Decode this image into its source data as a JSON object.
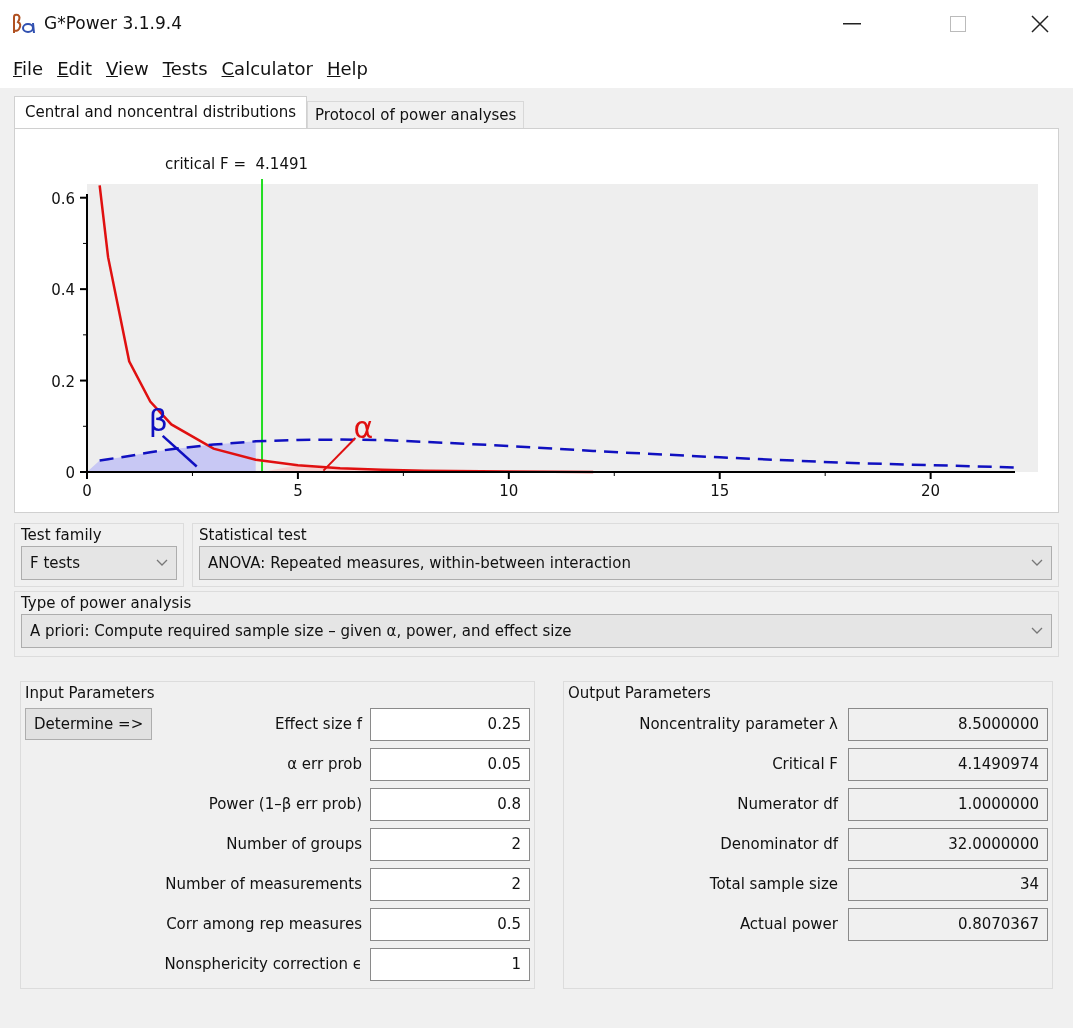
{
  "window": {
    "title": "G*Power 3.1.9.4"
  },
  "menu": [
    "File",
    "Edit",
    "View",
    "Tests",
    "Calculator",
    "Help"
  ],
  "tabs": [
    {
      "label": "Central and noncentral distributions",
      "selected": true
    },
    {
      "label": "Protocol of power analyses",
      "selected": false
    }
  ],
  "chart_data": {
    "type": "line",
    "x": [
      0.3,
      0.5,
      1,
      1.5,
      2,
      3,
      4,
      5,
      6,
      7,
      8,
      10,
      12,
      15,
      18,
      22
    ],
    "series": [
      {
        "color": "#e01010",
        "line_style": "solid",
        "values": [
          0.627,
          0.47,
          0.242,
          0.154,
          0.104,
          0.051,
          0.027,
          0.015,
          0.008,
          0.005,
          0.003,
          0.001,
          0,
          null,
          null,
          null
        ]
      },
      {
        "color": "#1010c0",
        "line_style": "dashed",
        "values": [
          0.025,
          0.028,
          0.035,
          0.043,
          0.05,
          0.06,
          0.067,
          0.07,
          0.071,
          0.07,
          0.066,
          0.057,
          0.046,
          0.032,
          0.02,
          0.01
        ]
      }
    ],
    "ref_lines": [
      {
        "axis": "x",
        "value": 4.1491,
        "color": "#22dd22"
      }
    ],
    "xlim": [
      0,
      22
    ],
    "ylim": [
      0,
      0.63
    ],
    "xticks": [
      0,
      5,
      10,
      15,
      20
    ],
    "yticks": [
      0,
      0.2,
      0.4,
      0.6
    ],
    "annotations": [
      "critical F =  4.1491",
      "β",
      "α"
    ]
  },
  "test_family": {
    "label": "Test family",
    "value": "F tests"
  },
  "statistical_test": {
    "label": "Statistical test",
    "value": "ANOVA: Repeated measures, within-between interaction"
  },
  "power_analysis": {
    "label": "Type of power analysis",
    "value": "A priori: Compute required sample size – given α, power, and effect size"
  },
  "input_parameters": {
    "title": "Input Parameters",
    "button": "Determine =>",
    "rows": [
      {
        "label": "Effect size f",
        "value": "0.25"
      },
      {
        "label": "α err prob",
        "value": "0.05"
      },
      {
        "label": "Power (1–β err prob)",
        "value": "0.8"
      },
      {
        "label": "Number of groups",
        "value": "2"
      },
      {
        "label": "Number of measurements",
        "value": "2"
      },
      {
        "label": "Corr among rep measures",
        "value": "0.5"
      },
      {
        "label": "Nonsphericity correction ϵ",
        "value": "1"
      }
    ]
  },
  "output_parameters": {
    "title": "Output Parameters",
    "rows": [
      {
        "label": "Noncentrality parameter λ",
        "value": "8.5000000"
      },
      {
        "label": "Critical F",
        "value": "4.1490974"
      },
      {
        "label": "Numerator df",
        "value": "1.0000000"
      },
      {
        "label": "Denominator df",
        "value": "32.0000000"
      },
      {
        "label": "Total sample size",
        "value": "34"
      },
      {
        "label": "Actual power",
        "value": "0.8070367"
      }
    ]
  }
}
